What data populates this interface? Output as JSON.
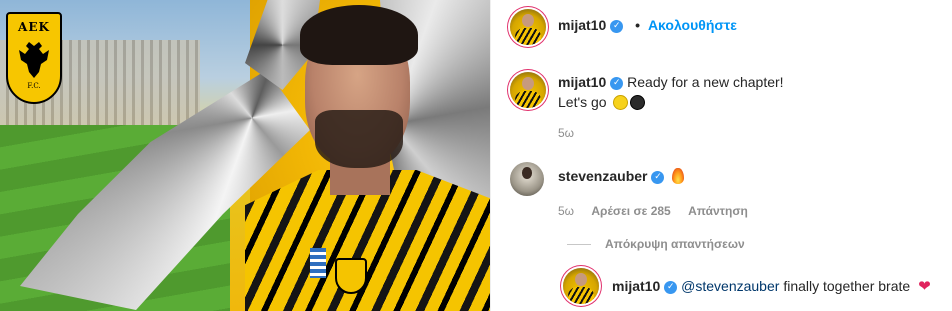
{
  "post": {
    "logo_text": "ΑΕΚ",
    "logo_fc": "F.C."
  },
  "header": {
    "username": "mijat10",
    "verified_icon": "✓",
    "separator": "•",
    "follow_label": "Ακολουθήστε"
  },
  "caption": {
    "username": "mijat10",
    "text_line1": "Ready for a new chapter!",
    "text_line2": "Let's go",
    "emoji_names": [
      "yellow-circle-emoji",
      "black-circle-emoji"
    ],
    "time": "5ω"
  },
  "comment1": {
    "username": "stevenzauber",
    "emoji_name": "fire-emoji",
    "time": "5ω",
    "likes": "Αρέσει σε 285",
    "reply": "Απάντηση"
  },
  "hide_replies": "Απόκρυψη απαντήσεων",
  "reply1": {
    "username": "mijat10",
    "mention": "@stevenzauber",
    "text": "finally together brate",
    "heart": "❤"
  },
  "colors": {
    "accent": "#0095f6",
    "verified": "#3897f0",
    "aek_yellow": "#f5c400"
  }
}
